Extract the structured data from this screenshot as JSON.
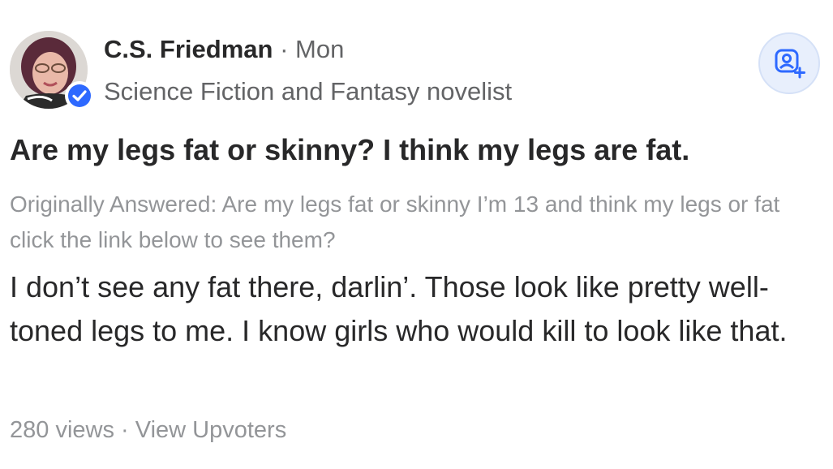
{
  "author": {
    "name": "C.S. Friedman",
    "separator": "·",
    "date": "Mon",
    "credential": "Science Fiction and Fantasy novelist",
    "verified_color": "#2e69ff"
  },
  "actions": {
    "follow_icon": "person-plus-icon",
    "follow_color": "#2e69ff"
  },
  "question": {
    "title": "Are my legs fat or skinny? I think my legs are fat.",
    "originally_answered": "Originally Answered: Are my legs fat or skinny I’m 13 and think my legs or fat click the link below to see them?"
  },
  "answer": {
    "text": "I don’t see any fat there, darlin’. Those look like pretty well-toned legs to me. I know girls who would kill to look like that."
  },
  "stats": {
    "views": "280 views",
    "separator": "·",
    "upvoters_link": "View Upvoters"
  }
}
